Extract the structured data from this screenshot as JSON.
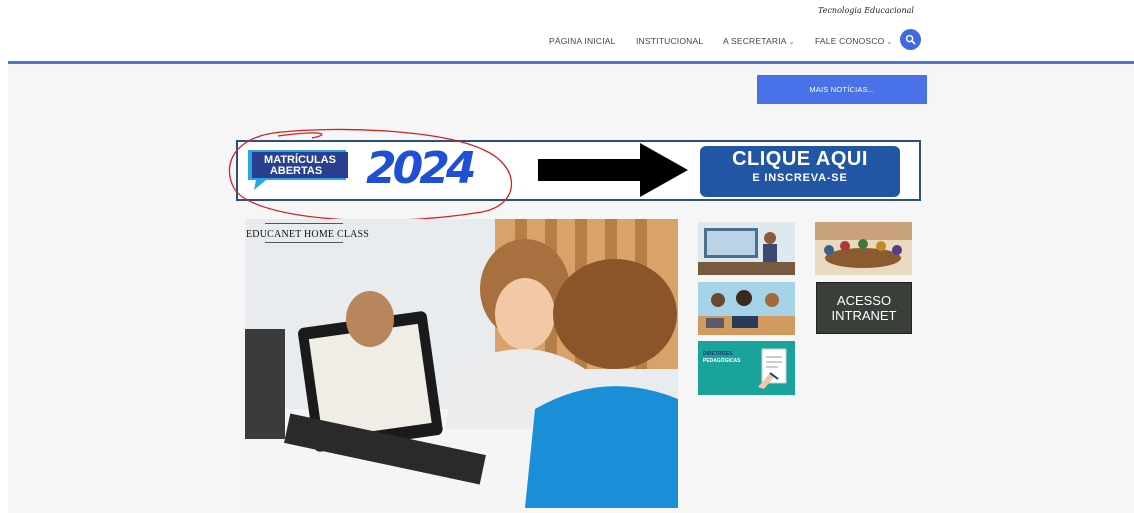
{
  "header": {
    "tagline": "Tecnologia Educacional",
    "nav": [
      {
        "label": "PÁGINA INICIAL",
        "has_dropdown": false
      },
      {
        "label": "INSTITUCIONAL",
        "has_dropdown": false
      },
      {
        "label": "A SECRETARIA",
        "has_dropdown": true
      },
      {
        "label": "FALE CONOSCO",
        "has_dropdown": true
      }
    ],
    "search_icon": "search-icon",
    "accent_color": "#4169e1"
  },
  "main": {
    "more_news_label": "MAIS NOTÍCIAS...",
    "banner": {
      "badge_line1": "MATRÍCULAS",
      "badge_line2": "ABERTAS",
      "year": "2024",
      "cta_line1": "CLIQUE AQUI",
      "cta_line2": "E INSCREVA-SE"
    },
    "feature_caption": "EDUCANET HOME CLASS",
    "tiles": {
      "intranet_line1": "ACESSO",
      "intranet_line2": "INTRANET",
      "diretrizes_line1": "DIRETRIZES",
      "diretrizes_line2": "PEDAGÓGICAS"
    }
  }
}
